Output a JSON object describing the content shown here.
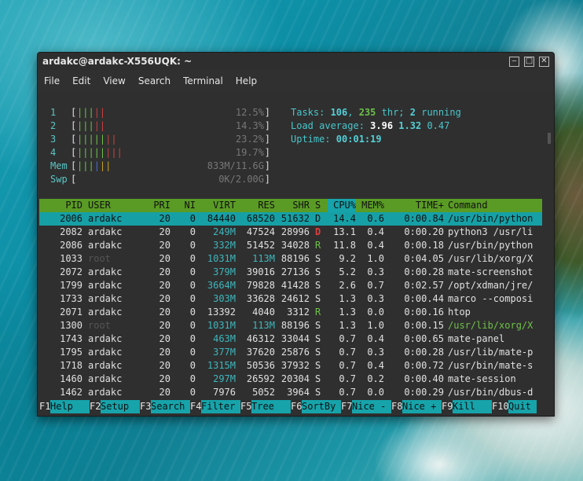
{
  "window": {
    "title": "ardakc@ardakc-X556UQK: ~",
    "controls": {
      "minimize": "‒",
      "maximize": "□",
      "close": "✕"
    }
  },
  "menu": [
    "File",
    "Edit",
    "View",
    "Search",
    "Terminal",
    "Help"
  ],
  "cpu_meters": [
    {
      "label": "1",
      "value": "12.5%",
      "segments": [
        {
          "color": "green",
          "n": 3
        },
        {
          "color": "red",
          "n": 2
        }
      ]
    },
    {
      "label": "2",
      "value": "14.3%",
      "segments": [
        {
          "color": "green",
          "n": 3
        },
        {
          "color": "red",
          "n": 2
        }
      ]
    },
    {
      "label": "3",
      "value": "23.2%",
      "segments": [
        {
          "color": "green",
          "n": 5
        },
        {
          "color": "red",
          "n": 2
        }
      ]
    },
    {
      "label": "4",
      "value": "19.7%",
      "segments": [
        {
          "color": "green",
          "n": 5
        },
        {
          "color": "red",
          "n": 3
        }
      ]
    }
  ],
  "mem_meter": {
    "label": "Mem",
    "value": "833M/11.6G",
    "segments": [
      {
        "color": "green",
        "n": 3
      },
      {
        "color": "blue",
        "n": 1
      },
      {
        "color": "yellow",
        "n": 2
      }
    ]
  },
  "swp_meter": {
    "label": "Swp",
    "value": "0K/2.00G",
    "segments": []
  },
  "summary": {
    "tasks_label": "Tasks: ",
    "tasks": "106",
    "sep1": ", ",
    "threads": "235",
    "thr_label": " thr; ",
    "running": "2",
    "running_label": " running",
    "load_label": "Load average: ",
    "load1": "3.96",
    "load5": "1.32",
    "load15": "0.47",
    "uptime_label": "Uptime: ",
    "uptime": "00:01:19"
  },
  "columns": [
    "PID",
    "USER",
    "PRI",
    "NI",
    "VIRT",
    "RES",
    "SHR",
    "S",
    "CPU%",
    "MEM%",
    "TIME+",
    "Command"
  ],
  "processes": [
    {
      "pid": "2006",
      "user": "ardakc",
      "pri": "20",
      "ni": "0",
      "virt": "84440",
      "res": "68520",
      "shr": "51632",
      "s": "D",
      "cpu": "14.4",
      "mem": "0.6",
      "time": "0:00.84",
      "cmd": "/usr/bin/python"
    },
    {
      "pid": "2082",
      "user": "ardakc",
      "pri": "20",
      "ni": "0",
      "virt": "249M",
      "res": "47524",
      "shr": "28996",
      "s": "D",
      "cpu": "13.1",
      "mem": "0.4",
      "time": "0:00.20",
      "cmd": "python3 /usr/li"
    },
    {
      "pid": "2086",
      "user": "ardakc",
      "pri": "20",
      "ni": "0",
      "virt": "332M",
      "res": "51452",
      "shr": "34028",
      "s": "R",
      "cpu": "11.8",
      "mem": "0.4",
      "time": "0:00.18",
      "cmd": "/usr/bin/python"
    },
    {
      "pid": "1033",
      "user": "root",
      "pri": "20",
      "ni": "0",
      "virt": "1031M",
      "res": "113M",
      "shr": "88196",
      "s": "S",
      "cpu": "9.2",
      "mem": "1.0",
      "time": "0:04.05",
      "cmd": "/usr/lib/xorg/X"
    },
    {
      "pid": "2072",
      "user": "ardakc",
      "pri": "20",
      "ni": "0",
      "virt": "379M",
      "res": "39016",
      "shr": "27136",
      "s": "S",
      "cpu": "5.2",
      "mem": "0.3",
      "time": "0:00.28",
      "cmd": "mate-screenshot"
    },
    {
      "pid": "1799",
      "user": "ardakc",
      "pri": "20",
      "ni": "0",
      "virt": "3664M",
      "res": "79828",
      "shr": "41428",
      "s": "S",
      "cpu": "2.6",
      "mem": "0.7",
      "time": "0:02.57",
      "cmd": "/opt/xdman/jre/"
    },
    {
      "pid": "1733",
      "user": "ardakc",
      "pri": "20",
      "ni": "0",
      "virt": "303M",
      "res": "33628",
      "shr": "24612",
      "s": "S",
      "cpu": "1.3",
      "mem": "0.3",
      "time": "0:00.44",
      "cmd": "marco --composi"
    },
    {
      "pid": "2071",
      "user": "ardakc",
      "pri": "20",
      "ni": "0",
      "virt": "13392",
      "res": "4040",
      "shr": "3312",
      "s": "R",
      "cpu": "1.3",
      "mem": "0.0",
      "time": "0:00.16",
      "cmd": "htop"
    },
    {
      "pid": "1300",
      "user": "root",
      "pri": "20",
      "ni": "0",
      "virt": "1031M",
      "res": "113M",
      "shr": "88196",
      "s": "S",
      "cpu": "1.3",
      "mem": "1.0",
      "time": "0:00.15",
      "cmd": "/usr/lib/xorg/X"
    },
    {
      "pid": "1743",
      "user": "ardakc",
      "pri": "20",
      "ni": "0",
      "virt": "463M",
      "res": "46312",
      "shr": "33044",
      "s": "S",
      "cpu": "0.7",
      "mem": "0.4",
      "time": "0:00.65",
      "cmd": "mate-panel"
    },
    {
      "pid": "1795",
      "user": "ardakc",
      "pri": "20",
      "ni": "0",
      "virt": "377M",
      "res": "37620",
      "shr": "25876",
      "s": "S",
      "cpu": "0.7",
      "mem": "0.3",
      "time": "0:00.28",
      "cmd": "/usr/lib/mate-p"
    },
    {
      "pid": "1718",
      "user": "ardakc",
      "pri": "20",
      "ni": "0",
      "virt": "1315M",
      "res": "50536",
      "shr": "37932",
      "s": "S",
      "cpu": "0.7",
      "mem": "0.4",
      "time": "0:00.72",
      "cmd": "/usr/bin/mate-s"
    },
    {
      "pid": "1460",
      "user": "ardakc",
      "pri": "20",
      "ni": "0",
      "virt": "297M",
      "res": "26592",
      "shr": "20304",
      "s": "S",
      "cpu": "0.7",
      "mem": "0.2",
      "time": "0:00.40",
      "cmd": "mate-session"
    },
    {
      "pid": "1462",
      "user": "ardakc",
      "pri": "20",
      "ni": "0",
      "virt": "7976",
      "res": "5052",
      "shr": "3964",
      "s": "S",
      "cpu": "0.7",
      "mem": "0.0",
      "time": "0:00.29",
      "cmd": "/usr/bin/dbus-d"
    }
  ],
  "fkeys": [
    {
      "key": "F1",
      "label": "Help"
    },
    {
      "key": "F2",
      "label": "Setup"
    },
    {
      "key": "F3",
      "label": "Search"
    },
    {
      "key": "F4",
      "label": "Filter"
    },
    {
      "key": "F5",
      "label": "Tree"
    },
    {
      "key": "F6",
      "label": "SortBy"
    },
    {
      "key": "F7",
      "label": "Nice -"
    },
    {
      "key": "F8",
      "label": "Nice +"
    },
    {
      "key": "F9",
      "label": "Kill"
    },
    {
      "key": "F10",
      "label": "Quit"
    }
  ],
  "colors": {
    "header_bg": "#5a9b25",
    "selected_bg": "#16a0a6",
    "fkey_bg": "#17a3aa",
    "terminal_bg": "#2f2f2f"
  }
}
